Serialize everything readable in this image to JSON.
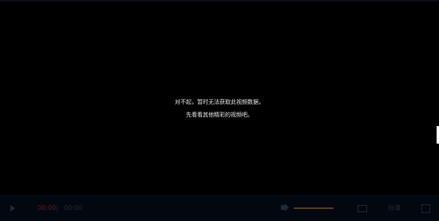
{
  "player": {
    "error_message": {
      "line1": "对不起，暂时无法获取此视频数据，",
      "line2": "先看看其他精彩的视频吧。"
    },
    "controls": {
      "time_current": "00:00",
      "time_separator": "|",
      "time_total": "00:00",
      "quality_label": "标清",
      "volume_level": 1.0
    },
    "icons": {
      "play": "play-icon",
      "volume": "volume-icon",
      "caption": "caption-icon",
      "fullscreen": "fullscreen-icon"
    },
    "colors": {
      "background": "#000000",
      "message_text": "#e8e8e8",
      "control_bar": "#030810",
      "current_time": "#5b1e1e",
      "volume_fill": "#5a3a14"
    }
  }
}
